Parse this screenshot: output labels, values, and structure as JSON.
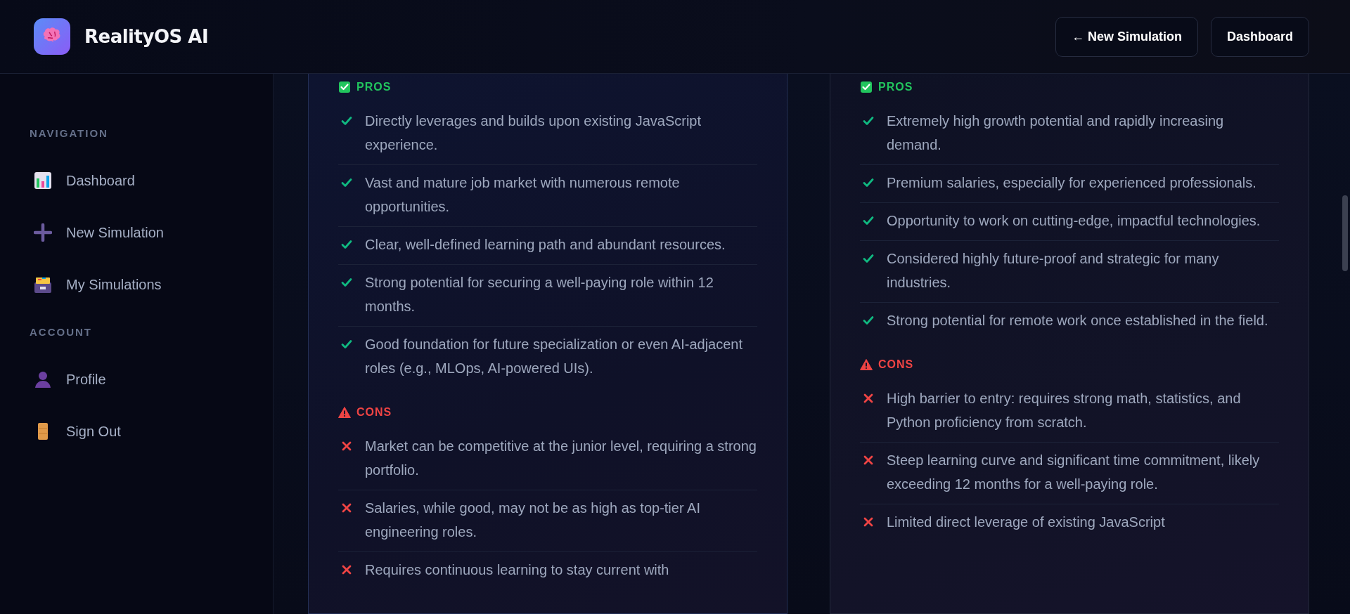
{
  "header": {
    "app_name": "RealityOS AI",
    "buttons": [
      {
        "label": "← New Simulation"
      },
      {
        "label": "Dashboard"
      }
    ]
  },
  "sidebar": {
    "groups": [
      {
        "heading": "NAVIGATION",
        "items": [
          {
            "label": "Dashboard",
            "kind": "chart"
          },
          {
            "label": "New Simulation",
            "kind": "plus"
          },
          {
            "label": "My Simulations",
            "kind": "cabinet"
          }
        ]
      },
      {
        "heading": "ACCOUNT",
        "items": [
          {
            "label": "Profile",
            "kind": "person"
          },
          {
            "label": "Sign Out",
            "kind": "door"
          }
        ]
      }
    ]
  },
  "comparison": {
    "columns": [
      {
        "sections": [
          {
            "kind": "pros",
            "heading": "PROS",
            "items": [
              "Directly leverages and builds upon existing JavaScript experience.",
              "Vast and mature job market with numerous remote opportunities.",
              "Clear, well-defined learning path and abundant resources.",
              "Strong potential for securing a well-paying role within 12 months.",
              "Good foundation for future specialization or even AI-adjacent roles (e.g., MLOps, AI-powered UIs)."
            ]
          },
          {
            "kind": "cons",
            "heading": "CONS",
            "items": [
              "Market can be competitive at the junior level, requiring a strong portfolio.",
              "Salaries, while good, may not be as high as top-tier AI engineering roles.",
              "Requires continuous learning to stay current with"
            ]
          }
        ]
      },
      {
        "sections": [
          {
            "kind": "pros",
            "heading": "PROS",
            "items": [
              "Extremely high growth potential and rapidly increasing demand.",
              "Premium salaries, especially for experienced professionals.",
              "Opportunity to work on cutting-edge, impactful technologies.",
              "Considered highly future-proof and strategic for many industries.",
              "Strong potential for remote work once established in the field."
            ]
          },
          {
            "kind": "cons",
            "heading": "CONS",
            "items": [
              "High barrier to entry: requires strong math, statistics, and Python proficiency from scratch.",
              "Steep learning curve and significant time commitment, likely exceeding 12 months for a well-paying role.",
              "Limited direct leverage of existing JavaScript"
            ]
          }
        ]
      }
    ]
  }
}
